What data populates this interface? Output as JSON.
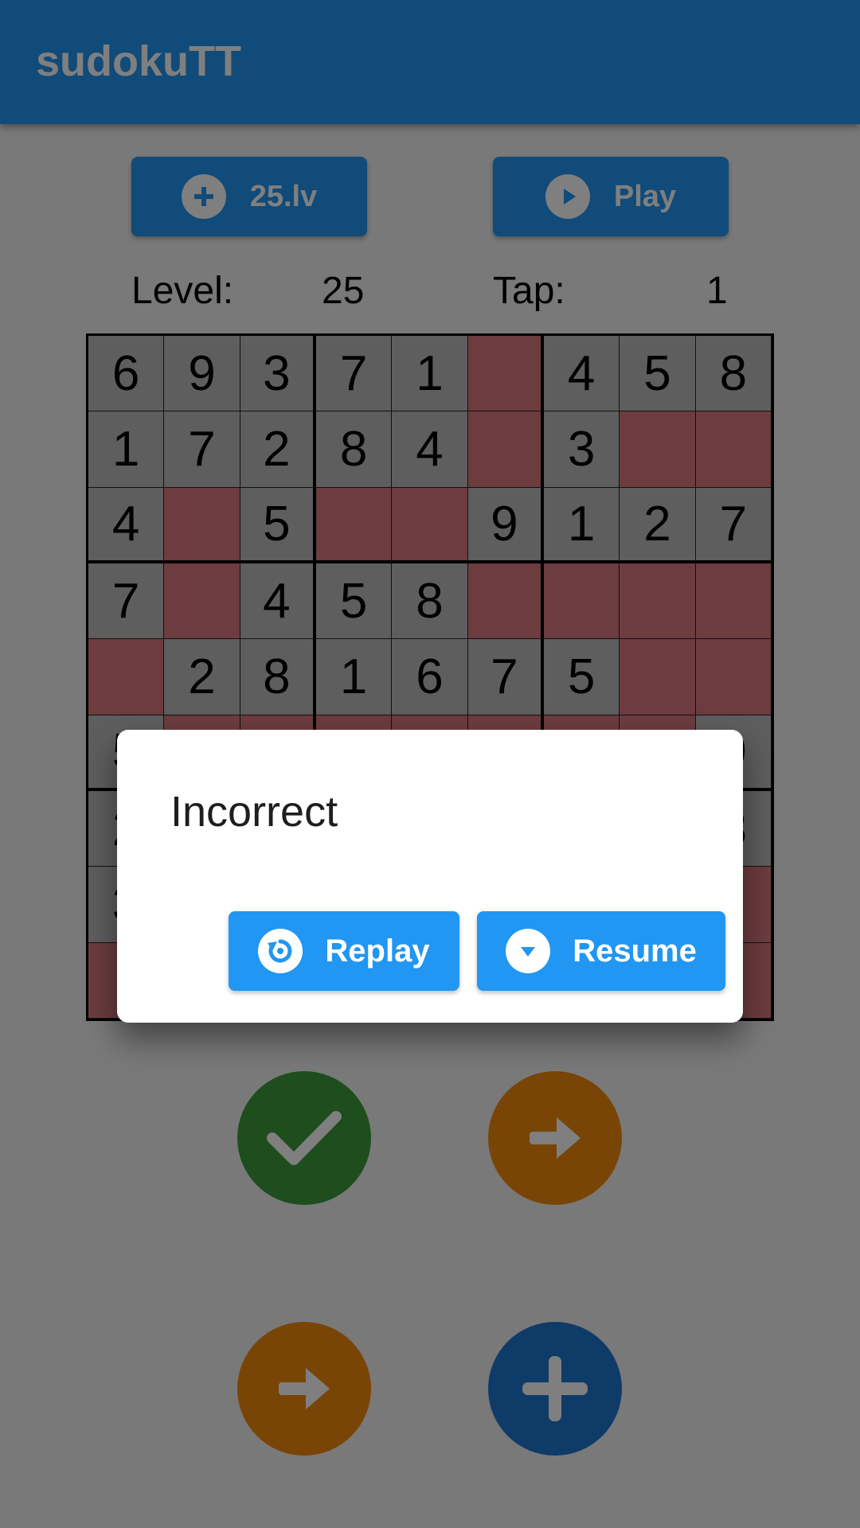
{
  "appbar": {
    "title": "sudokuTT"
  },
  "toolbar": {
    "level_button_label": "25.lv",
    "play_button_label": "Play"
  },
  "info": {
    "level_label": "Level:",
    "level_value": "25",
    "tap_label": "Tap:",
    "tap_value": "1"
  },
  "board": {
    "rows": [
      [
        "6",
        "9",
        "3",
        "7",
        "1",
        "",
        "4",
        "5",
        "8"
      ],
      [
        "1",
        "7",
        "2",
        "8",
        "4",
        "",
        "3",
        "",
        ""
      ],
      [
        "4",
        "",
        "5",
        "",
        "",
        "9",
        "1",
        "2",
        "7"
      ],
      [
        "7",
        "",
        "4",
        "5",
        "8",
        "",
        "",
        "",
        ""
      ],
      [
        "",
        "2",
        "8",
        "1",
        "6",
        "7",
        "5",
        "",
        ""
      ],
      [
        "5",
        "",
        "",
        "",
        "",
        "",
        "",
        "",
        "9"
      ],
      [
        "2",
        "",
        "",
        "",
        "",
        "",
        "",
        "",
        "3"
      ],
      [
        "3",
        "",
        "",
        "",
        "",
        "",
        "",
        "",
        ""
      ],
      [
        "",
        "",
        "",
        "",
        "",
        "",
        "",
        "",
        ""
      ]
    ],
    "colors": {
      "given": "#bdbdbd",
      "empty": "#d9797f"
    }
  },
  "actions": {
    "check": {
      "icon": "check-icon",
      "color": "#3c9a3c"
    },
    "next_green_row": {
      "icon": "arrow-right-icon",
      "color": "#f28a0e"
    },
    "next_bottom": {
      "icon": "arrow-right-icon",
      "color": "#f28a0e"
    },
    "add": {
      "icon": "plus-icon",
      "color": "#1f77d0"
    }
  },
  "dialog": {
    "title": "Incorrect",
    "replay_label": "Replay",
    "resume_label": "Resume"
  },
  "colors": {
    "primary": "#2196f3",
    "scrim": "rgba(0,0,0,0.5)"
  }
}
